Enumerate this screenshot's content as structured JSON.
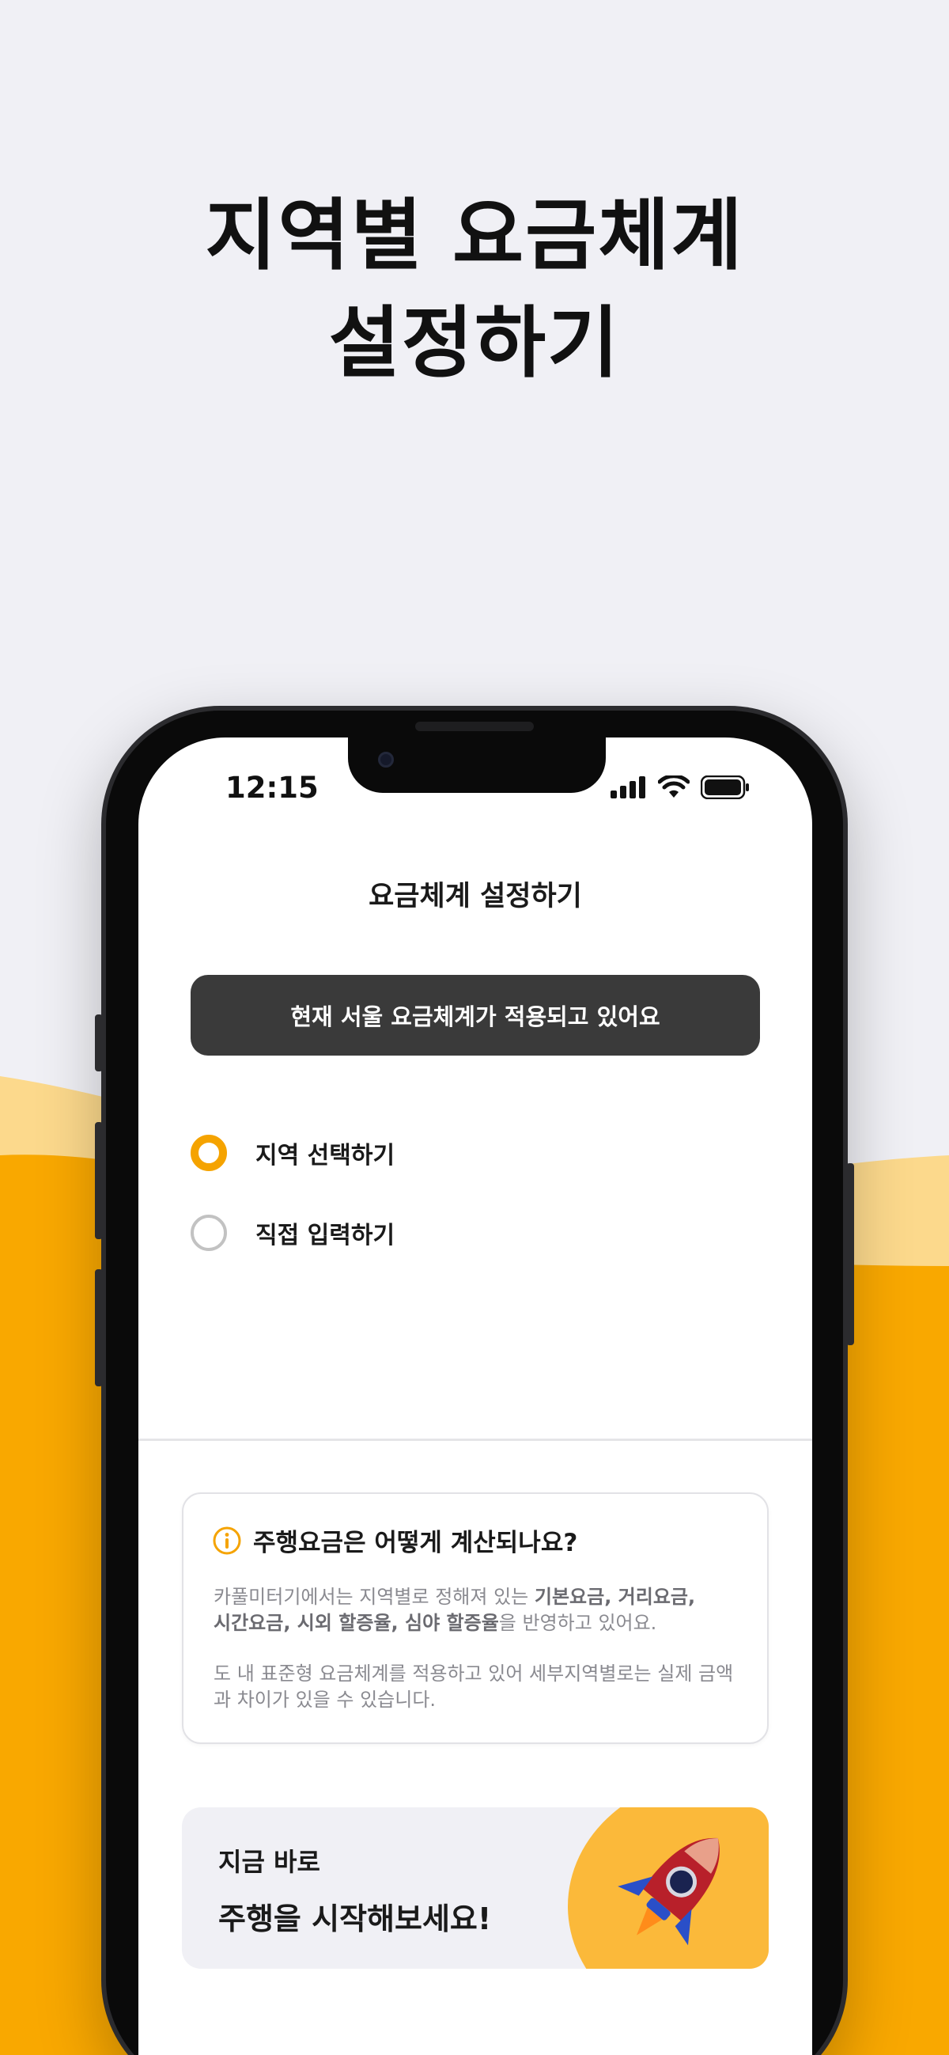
{
  "hero": {
    "title_line1": "지역별 요금체계",
    "title_line2": "설정하기"
  },
  "status_bar": {
    "time": "12:15",
    "icons": [
      "signal-icon",
      "wifi-icon",
      "battery-icon"
    ]
  },
  "screen": {
    "title": "요금체계 설정하기",
    "banner": "현재 서울 요금체계가 적용되고 있어요",
    "options": [
      {
        "label": "지역 선택하기",
        "selected": true
      },
      {
        "label": "직접 입력하기",
        "selected": false
      }
    ]
  },
  "info": {
    "icon": "info-icon",
    "title": "주행요금은 어떻게 계산되나요?",
    "p1_pre": "카풀미터기에서는 지역별로 정해져 있는 ",
    "p1_bold1": "기본요금, 거리요금,",
    "p1_bold2": "시간요금, 시외 할증율, 심야 할증율",
    "p1_post": "을  반영하고 있어요.",
    "p2": "도 내 표준형 요금체계를 적용하고 있어 세부지역별로는 실제 금액과 차이가 있을 수 있습니다."
  },
  "cta": {
    "sub": "지금 바로",
    "main": "주행을 시작해보세요!",
    "image": "rocket-illustration"
  },
  "colors": {
    "accent": "#f5a300",
    "background": "#f0f0f5",
    "banner_bg": "#3a3a3a",
    "wave_light": "#fcd98c",
    "wave_main": "#f9a800"
  }
}
